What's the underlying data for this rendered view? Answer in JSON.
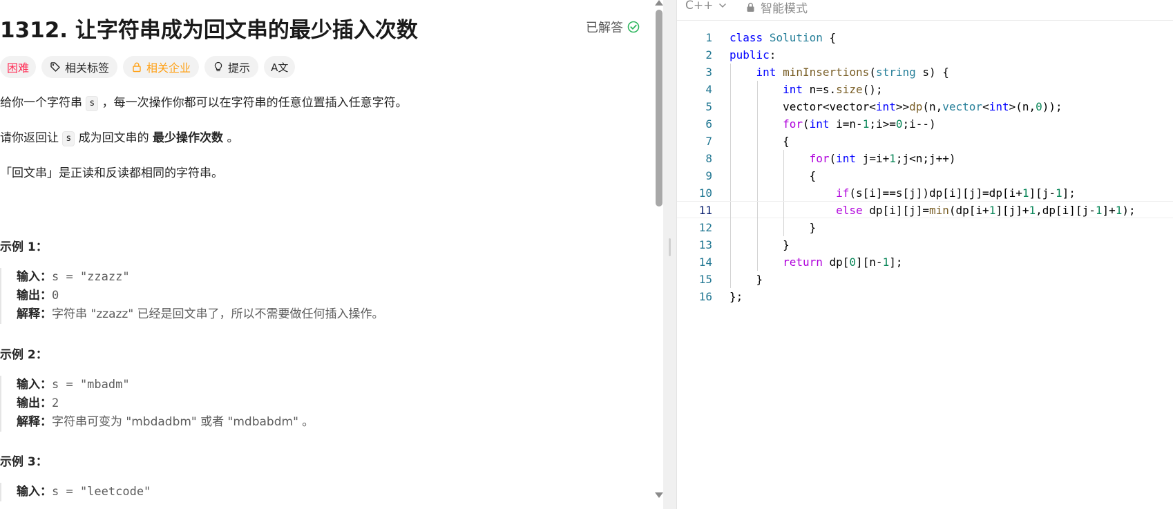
{
  "problem": {
    "title": "1312. 让字符串成为回文串的最少插入次数",
    "solved_label": "已解答",
    "tags": {
      "difficulty": "困难",
      "topics": "相关标签",
      "companies": "相关企业",
      "hint": "提示",
      "translate": "A文"
    },
    "description": {
      "p1_a": "给你一个字符串 ",
      "p1_code": "s",
      "p1_b": " ，每一次操作你都可以在字符串的任意位置插入任意字符。",
      "p2_a": "请你返回让 ",
      "p2_code": "s",
      "p2_b": " 成为回文串的 ",
      "p2_bold": "最少操作次数",
      "p2_c": " 。",
      "p3": "「回文串」是正读和反读都相同的字符串。"
    },
    "examples": [
      {
        "title": "示例 1：",
        "input_label": "输入：",
        "input": "s = \"zzazz\"",
        "output_label": "输出：",
        "output": "0",
        "explanation_label": "解释：",
        "explanation": "字符串 \"zzazz\" 已经是回文串了，所以不需要做任何插入操作。"
      },
      {
        "title": "示例 2：",
        "input_label": "输入：",
        "input": "s = \"mbadm\"",
        "output_label": "输出：",
        "output": "2",
        "explanation_label": "解释：",
        "explanation": "字符串可变为 \"mbdadbm\" 或者 \"mdbabdm\" 。"
      },
      {
        "title": "示例 3：",
        "input_label": "输入：",
        "input": "s = \"leetcode\""
      }
    ]
  },
  "editor": {
    "language": "C++",
    "mode": "智能模式",
    "current_line": 11,
    "lines": [
      {
        "n": "1",
        "tokens": [
          [
            "kw",
            "class"
          ],
          [
            "",
            " "
          ],
          [
            "tp",
            "Solution"
          ],
          [
            "",
            " {"
          ]
        ]
      },
      {
        "n": "2",
        "tokens": [
          [
            "kw",
            "public"
          ],
          [
            "",
            ":"
          ]
        ]
      },
      {
        "n": "3",
        "tokens": [
          [
            "",
            "    "
          ],
          [
            "kw",
            "int"
          ],
          [
            "",
            " "
          ],
          [
            "fn",
            "minInsertions"
          ],
          [
            "",
            "("
          ],
          [
            "tp",
            "string"
          ],
          [
            "",
            " s) {"
          ]
        ]
      },
      {
        "n": "4",
        "tokens": [
          [
            "",
            "        "
          ],
          [
            "kw",
            "int"
          ],
          [
            "",
            " n=s."
          ],
          [
            "fn",
            "size"
          ],
          [
            "",
            "();"
          ]
        ]
      },
      {
        "n": "5",
        "tokens": [
          [
            "",
            "        vector<vector<"
          ],
          [
            "kw",
            "int"
          ],
          [
            "",
            ">>"
          ],
          [
            "fn",
            "dp"
          ],
          [
            "",
            "(n,"
          ],
          [
            "tp",
            "vector"
          ],
          [
            "",
            "<"
          ],
          [
            "kw",
            "int"
          ],
          [
            "",
            ">(n,"
          ],
          [
            "num",
            "0"
          ],
          [
            "",
            "));"
          ]
        ]
      },
      {
        "n": "6",
        "tokens": [
          [
            "",
            "        "
          ],
          [
            "ctl",
            "for"
          ],
          [
            "",
            "("
          ],
          [
            "kw",
            "int"
          ],
          [
            "",
            " i=n-"
          ],
          [
            "num",
            "1"
          ],
          [
            "",
            ";i>="
          ],
          [
            "num",
            "0"
          ],
          [
            "",
            ";i--)"
          ]
        ]
      },
      {
        "n": "7",
        "tokens": [
          [
            "",
            "        {"
          ]
        ]
      },
      {
        "n": "8",
        "tokens": [
          [
            "",
            "            "
          ],
          [
            "ctl",
            "for"
          ],
          [
            "",
            "("
          ],
          [
            "kw",
            "int"
          ],
          [
            "",
            " j=i+"
          ],
          [
            "num",
            "1"
          ],
          [
            "",
            ";j<n;j++)"
          ]
        ]
      },
      {
        "n": "9",
        "tokens": [
          [
            "",
            "            {"
          ]
        ]
      },
      {
        "n": "10",
        "tokens": [
          [
            "",
            "                "
          ],
          [
            "ctl",
            "if"
          ],
          [
            "",
            "(s[i]==s[j])dp[i][j]=dp[i+"
          ],
          [
            "num",
            "1"
          ],
          [
            "",
            "][j-"
          ],
          [
            "num",
            "1"
          ],
          [
            "",
            "];"
          ]
        ]
      },
      {
        "n": "11",
        "tokens": [
          [
            "",
            "                "
          ],
          [
            "ctl",
            "else"
          ],
          [
            "",
            " dp[i][j]="
          ],
          [
            "fn",
            "min"
          ],
          [
            "",
            "(dp[i+"
          ],
          [
            "num",
            "1"
          ],
          [
            "",
            "][j]+"
          ],
          [
            "num",
            "1"
          ],
          [
            "",
            ",dp[i][j-"
          ],
          [
            "num",
            "1"
          ],
          [
            "",
            "]+"
          ],
          [
            "num",
            "1"
          ],
          [
            "",
            ");"
          ]
        ]
      },
      {
        "n": "12",
        "tokens": [
          [
            "",
            "            }"
          ]
        ]
      },
      {
        "n": "13",
        "tokens": [
          [
            "",
            "        }"
          ]
        ]
      },
      {
        "n": "14",
        "tokens": [
          [
            "",
            "        "
          ],
          [
            "ctl",
            "return"
          ],
          [
            "",
            " dp["
          ],
          [
            "num",
            "0"
          ],
          [
            "",
            "][n-"
          ],
          [
            "num",
            "1"
          ],
          [
            "",
            "];"
          ]
        ]
      },
      {
        "n": "15",
        "tokens": [
          [
            "",
            "    }"
          ]
        ]
      },
      {
        "n": "16",
        "tokens": [
          [
            "",
            "};"
          ]
        ]
      }
    ]
  },
  "colors": {
    "difficulty_hard": "#ff2d55",
    "companies": "#ffa116",
    "solved_check": "#2db55d",
    "keyword": "#0000ff",
    "type": "#267f99",
    "function": "#795e26",
    "control": "#af00db",
    "number": "#098658",
    "line_number": "#237893"
  }
}
